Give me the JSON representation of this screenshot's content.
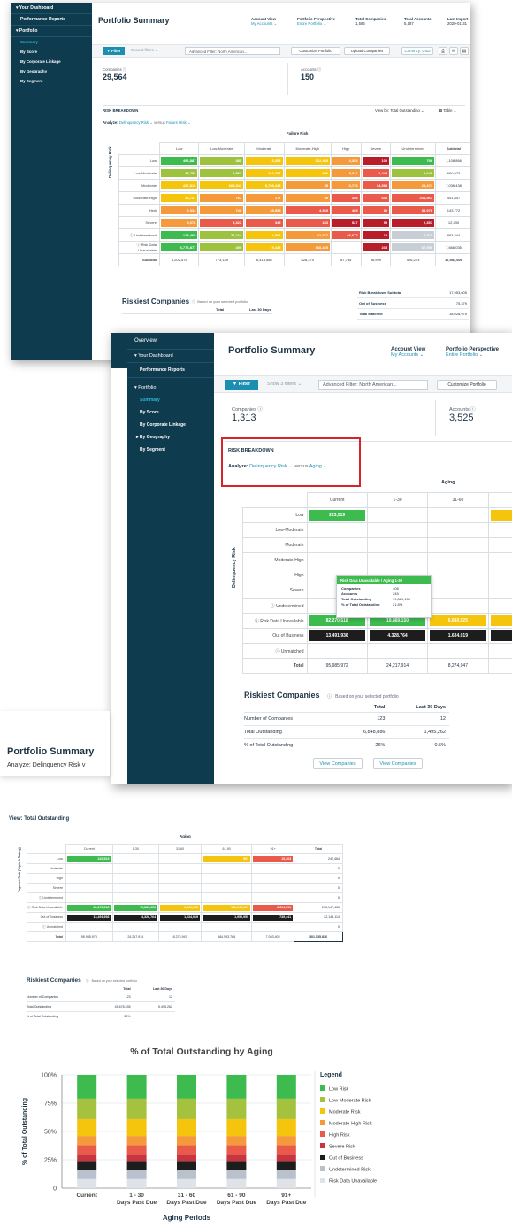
{
  "screen1": {
    "sidebar": {
      "your_dashboard": "▾ Your Dashboard",
      "performance_reports": "Performance Reports",
      "portfolio": "▾ Portfolio",
      "items": [
        "Summary",
        "By Score",
        "By Corporate Linkage",
        "By Geography",
        "By Segment"
      ]
    },
    "title": "Portfolio Summary",
    "header": {
      "account_view_label": "Account View",
      "account_view_value": "My Accounts ⌄",
      "perspective_label": "Portfolio Perspective",
      "perspective_value": "Entire Portfolio ⌄",
      "total_companies_label": "Total Companies",
      "total_companies_value": "1,586",
      "total_accounts_label": "Total Accounts",
      "total_accounts_value": "5,187",
      "last_import_label": "Last Import",
      "last_import_value": "2020-01-31"
    },
    "toolbar": {
      "filter": "▼ Filter",
      "show_filters": "Show 3 filters ⌄",
      "advanced_filter": "Advanced Filter: North American...",
      "customize": "Customize Portfolio",
      "upload": "Upload Companies",
      "currency": "Currency: USD"
    },
    "companies_label": "Companies ⓘ",
    "companies_value": "29,564",
    "accounts_label": "Accounts ⓘ",
    "accounts_value": "150",
    "risk_breakdown": "RISK BREAKDOWN",
    "view_by": "View by: Total Outstanding ⌄",
    "table_toggle": "Table ⌄",
    "analyze_label": "Analyze:",
    "analyze_value": "Delinquency Risk ⌄",
    "versus": "versus",
    "versus_value": "Failure Risk ⌄",
    "col_group": "Failure Risk",
    "row_axis": "Delinquency Risk",
    "columns": [
      "Low",
      "Low-Moderate",
      "Moderate",
      "Moderate-High",
      "High",
      "Severe",
      "Undetermined",
      "Subtotal"
    ],
    "rows": [
      {
        "label": "Low",
        "cells": [
          "496,887",
          "485",
          "3,355",
          "322,455",
          "4,353",
          "100",
          "798"
        ],
        "subtotal": "1,108,866"
      },
      {
        "label": "Low-Moderate",
        "cells": [
          "45,753",
          "4,563",
          "343,754",
          "596",
          "8,811",
          "1,245",
          "2,645"
        ],
        "subtotal": "660,973"
      },
      {
        "label": "Moderate",
        "cells": [
          "437,810",
          "668,543",
          "5,798,443",
          "35",
          "6,776",
          "34,568",
          "24,474"
        ],
        "subtotal": "7,036,438"
      },
      {
        "label": "Moderate-High",
        "cells": [
          "36,707",
          "767",
          "177",
          "55",
          "356",
          "646",
          "334,567"
        ],
        "subtotal": "441,847"
      },
      {
        "label": "High",
        "cells": [
          "6,334",
          "746",
          "45,555",
          "4,565",
          "465",
          "89",
          "85,976"
        ],
        "subtotal": "143,772"
      },
      {
        "label": "Severe",
        "cells": [
          "5,678",
          "3,322",
          "345",
          "183",
          "527",
          "99",
          "2,357"
        ],
        "subtotal": "12,430"
      },
      {
        "label": "ⓘ Undetermined",
        "cells": [
          "123,465",
          "74,214",
          "4,566",
          "21,577",
          "66,677",
          "14",
          "5,321"
        ],
        "subtotal": "883,244"
      },
      {
        "label": "ⓘ Risk Data Unavailable",
        "cells": [
          "6,776,877",
          "499",
          "5,433",
          "468,435",
          "",
          "238",
          "67,599"
        ],
        "subtotal": "7,666,035"
      }
    ],
    "subtotal_row": {
      "label": "Subtotal",
      "cells": [
        "8,202,575",
        "773,149",
        "6,413,586",
        "828,474",
        "87,785",
        "36,999",
        "526,223"
      ],
      "total": "17,953,605"
    },
    "riskiest_title": "Riskiest Companies",
    "riskiest_note": "Based on your selected portfolio",
    "riskiest_cols": [
      "Total",
      "Last 30 Days"
    ],
    "summary_right": [
      {
        "label": "Risk Breakdown Subtotal",
        "value": "17,953,605"
      },
      {
        "label": "Out of Business",
        "value": "75,379"
      },
      {
        "label": "Total Matched",
        "value": "18,028,975"
      }
    ]
  },
  "screen2": {
    "sidebar": {
      "overview": "Overview",
      "your_dashboard": "▾ Your Dashboard",
      "performance_reports": "Performance Reports",
      "portfolio": "▾ Portfolio",
      "items": [
        "Summary",
        "By Score",
        "By Corporate Linkage",
        "▸ By Geography",
        "By Segment"
      ]
    },
    "title": "Portfolio Summary",
    "account_view_label": "Account View",
    "account_view_value": "My Accounts ⌄",
    "perspective_label": "Portfolio Perspective",
    "perspective_value": "Entire Portfolio ⌄",
    "filter": "▼ Filter",
    "show_filters": "Show 3 filters ⌄",
    "advanced_filter": "Advanced Filter: North American...",
    "customize": "Customize Portfolio",
    "companies_label": "Companies ⓘ",
    "companies_value": "1,313",
    "accounts_label": "Accounts ⓘ",
    "accounts_value": "3,525",
    "risk_breakdown": "RISK BREAKDOWN",
    "analyze_label": "Analyze:",
    "analyze_value": "Delinquency Risk ⌄",
    "versus": "versus",
    "versus_value": "Aging ⌄",
    "col_group": "Aging",
    "row_axis": "Delinquency Risk",
    "columns": [
      "Current",
      "1-30",
      "31-60"
    ],
    "rows": [
      {
        "label": "Low",
        "cells": [
          "223,519",
          "",
          ""
        ]
      },
      {
        "label": "Low-Moderate",
        "cells": [
          "",
          "",
          ""
        ]
      },
      {
        "label": "Moderate",
        "cells": [
          "",
          "",
          ""
        ]
      },
      {
        "label": "Moderate-High",
        "cells": [
          "",
          "",
          ""
        ]
      },
      {
        "label": "High",
        "cells": [
          "",
          "",
          ""
        ]
      },
      {
        "label": "Severe",
        "cells": [
          "",
          "",
          ""
        ]
      },
      {
        "label": "ⓘ Undetermined",
        "cells": [
          "",
          "",
          ""
        ]
      },
      {
        "label": "ⓘ Risk Data Unavailable",
        "cells": [
          "82,270,518",
          "19,889,150",
          "6,640,925"
        ]
      },
      {
        "label": "Out of Business",
        "cells": [
          "13,491,936",
          "4,328,764",
          "1,634,019"
        ]
      },
      {
        "label": "ⓘ Unmatched",
        "cells": [
          "",
          "",
          ""
        ]
      }
    ],
    "total_row": {
      "label": "Total",
      "cells": [
        "95,985,972",
        "24,217,914",
        "8,274,947"
      ]
    },
    "tooltip": {
      "title": "Risk Data Unavailable / Aging 1-30",
      "rows": [
        {
          "k": "Companies",
          "v": "408"
        },
        {
          "k": "Accounts",
          "v": "245"
        },
        {
          "k": "Total Outstanding",
          "v": "19,889,150"
        },
        {
          "k": "% of Total Outstanding",
          "v": "21.8%"
        }
      ]
    },
    "riskiest_title": "Riskiest Companies",
    "riskiest_note": "Based on your selected portfolio",
    "riskiest_cols": [
      "Total",
      "Last 30 Days"
    ],
    "riskiest_rows": [
      {
        "label": "Number of Companies",
        "total": "123",
        "last30": "12"
      },
      {
        "label": "Total Outstanding",
        "total": "6,848,886",
        "last30": "1,495,262"
      },
      {
        "label": "% of Total Outstanding",
        "total": "26%",
        "last30": "0.5%"
      }
    ],
    "view_companies": "View Companies"
  },
  "card3": {
    "title": "Portfolio Summary",
    "analyze": "Analyze: Delinquency Risk v"
  },
  "screen4": {
    "view": "View: Total Outstanding",
    "col_group": "Aging",
    "row_axis": "Payment Risk (Triple A Rating)",
    "columns": [
      "Current",
      "1-30",
      "31-60",
      "61-90",
      "91+",
      "Total"
    ],
    "rows": [
      {
        "label": "Low",
        "cells": [
          "223,519",
          "",
          "",
          "997",
          "15,203"
        ],
        "total": "242,464"
      },
      {
        "label": "Moderate",
        "cells": [
          "",
          "",
          "",
          "",
          ""
        ],
        "total": "0"
      },
      {
        "label": "High",
        "cells": [
          "",
          "",
          "",
          "",
          ""
        ],
        "total": "0"
      },
      {
        "label": "Severe",
        "cells": [
          "",
          "",
          "",
          "",
          ""
        ],
        "total": "0"
      },
      {
        "label": "ⓘ Undetermined",
        "cells": [
          "",
          "",
          "",
          "",
          ""
        ],
        "total": "0"
      },
      {
        "label": "ⓘ Risk Data Unavailable",
        "cells": [
          "82,270,518",
          "19,889,150",
          "6,640,925",
          "182,642,101",
          "6,304,799"
        ],
        "total": "298,147,436"
      },
      {
        "label": "Out of Business",
        "cells": [
          "13,491,936",
          "4,328,764",
          "1,634,019",
          "1,950,955",
          "739,441"
        ],
        "total": "22,145,114"
      },
      {
        "label": "ⓘ Unmatched",
        "cells": [
          "",
          "",
          "",
          "",
          ""
        ],
        "total": "0"
      }
    ],
    "total_row": {
      "label": "Total",
      "cells": [
        "95,985,973",
        "24,217,914",
        "8,274,947",
        "184,593,786",
        "7,063,402"
      ],
      "total": "301,535,816"
    },
    "riskiest_title": "Riskiest Companies",
    "riskiest_note": "Based on your selected portfolio",
    "riskiest_cols": [
      "Total",
      "Last 30 Days"
    ],
    "riskiest_rows": [
      {
        "label": "Number of Companies",
        "total": "123",
        "last30": "12"
      },
      {
        "label": "Total Outstanding",
        "total": "45,678,535",
        "last30": "5,495,262"
      },
      {
        "label": "% of Total Outstanding",
        "total": "26%",
        "last30": ""
      }
    ]
  },
  "chart_data": {
    "type": "bar",
    "title": "% of Total Outstanding by Aging",
    "xlabel": "Aging Periods",
    "ylabel": "% of Total Outstanding",
    "ylim": [
      0,
      100
    ],
    "yticks": [
      "0",
      "25%",
      "50%",
      "75%",
      "100%"
    ],
    "categories": [
      "Current",
      "1 - 30 Days Past Due",
      "31 - 60 Days Past Due",
      "61 - 90 Days Past Due",
      "91+ Days Past Due"
    ],
    "legend_title": "Legend",
    "legend_position": "right",
    "stacked": true,
    "series": [
      {
        "name": "Risk Data Unavailable",
        "color": "#dfe3e8",
        "values": [
          8,
          8,
          8,
          8,
          8
        ]
      },
      {
        "name": "Undetermined Risk",
        "color": "#b9c1cc",
        "values": [
          8,
          8,
          8,
          8,
          8
        ]
      },
      {
        "name": "Out of Business",
        "color": "#1d1d1d",
        "values": [
          8,
          8,
          8,
          8,
          8
        ]
      },
      {
        "name": "Severe Risk",
        "color": "#c9343f",
        "values": [
          6,
          6,
          6,
          6,
          6
        ]
      },
      {
        "name": "High Risk",
        "color": "#e95a4a",
        "values": [
          8,
          8,
          8,
          8,
          8
        ]
      },
      {
        "name": "Moderate-High Risk",
        "color": "#f59a3b",
        "values": [
          8,
          8,
          8,
          8,
          8
        ]
      },
      {
        "name": "Moderate Risk",
        "color": "#f5c40d",
        "values": [
          15,
          15,
          15,
          15,
          15
        ]
      },
      {
        "name": "Low-Moderate Risk",
        "color": "#a4c23e",
        "values": [
          18,
          18,
          18,
          18,
          18
        ]
      },
      {
        "name": "Low Risk",
        "color": "#3dbb4f",
        "values": [
          21,
          21,
          21,
          21,
          21
        ]
      }
    ],
    "legend_order": [
      "Low Risk",
      "Low-Moderate Risk",
      "Moderate Risk",
      "Moderate-High Risk",
      "High Risk",
      "Severe Risk",
      "Out of Business",
      "Undetermined Risk",
      "Risk Data Unavailable"
    ]
  }
}
